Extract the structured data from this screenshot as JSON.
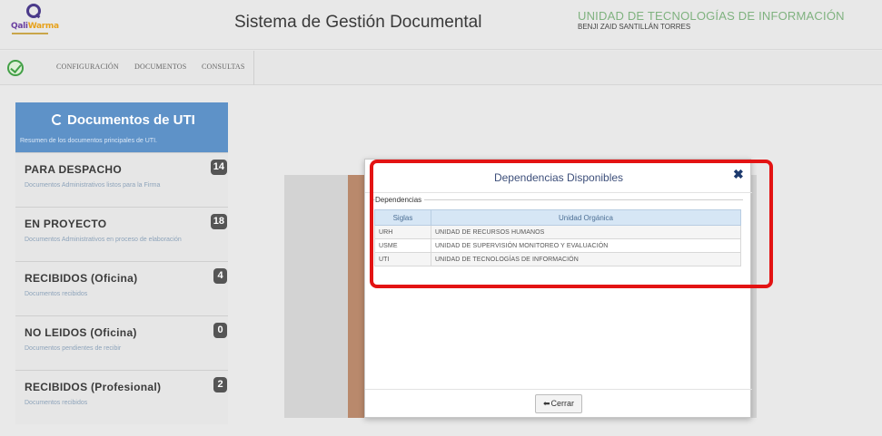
{
  "header": {
    "logo_text_a": "Qali",
    "logo_text_b": "Warma",
    "app_title": "Sistema de Gestión Documental",
    "unit_name": "UNIDAD DE TECNOLOGÍAS DE INFORMACIÓN",
    "user_name": "BENJI ZAID SANTILLÁN TORRES"
  },
  "nav": {
    "items": [
      {
        "label": "CONFIGURACIÓN"
      },
      {
        "label": "DOCUMENTOS"
      },
      {
        "label": "CONSULTAS"
      }
    ]
  },
  "sidebar": {
    "title": "Documentos de UTI",
    "subtitle": "Resumen de los documentos principales de UTI.",
    "items": [
      {
        "title": "PARA DESPACHO",
        "desc": "Documentos Administrativos listos para la Firma",
        "count": "14"
      },
      {
        "title": "EN PROYECTO",
        "desc": "Documentos Administrativos en proceso de elaboración",
        "count": "18"
      },
      {
        "title": "RECIBIDOS (Oficina)",
        "desc": "Documentos recibidos",
        "count": "4"
      },
      {
        "title": "NO LEIDOS (Oficina)",
        "desc": "Documentos pendientes de recibir",
        "count": "0"
      },
      {
        "title": "RECIBIDOS (Profesional)",
        "desc": "Documentos recibidos",
        "count": "2"
      }
    ]
  },
  "modal": {
    "title": "Dependencias Disponibles",
    "close_glyph": "✖",
    "legend": "Dependencias",
    "columns": [
      "Siglas",
      "Unidad Orgánica"
    ],
    "rows": [
      [
        "URH",
        "UNIDAD DE RECURSOS HUMANOS"
      ],
      [
        "USME",
        "UNIDAD DE SUPERVISIÓN MONITOREO Y EVALUACIÓN"
      ],
      [
        "UTI",
        "UNIDAD DE TECNOLOGÍAS DE INFORMACIÓN"
      ]
    ],
    "close_button_label": "Cerrar"
  },
  "icons": {
    "refresh": "refresh-icon",
    "check": "check-circle-icon",
    "close": "close-icon",
    "arrow_left": "arrow-left-icon"
  },
  "colors": {
    "sidebar_header": "#5e92c8",
    "highlight": "#e31313",
    "unit_name": "#7fb27f",
    "table_header": "#d6e6f5"
  }
}
